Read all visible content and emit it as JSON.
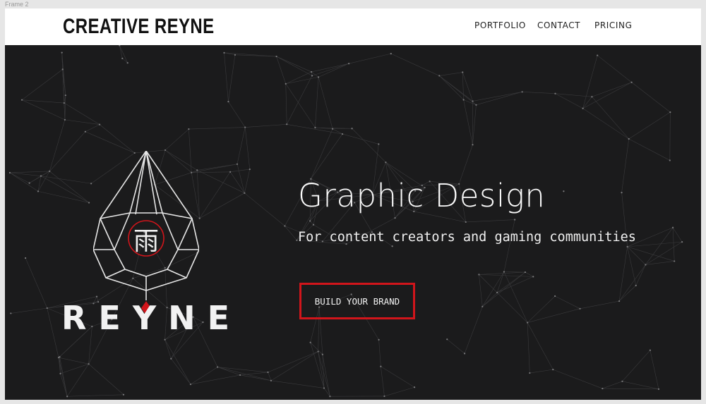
{
  "frame": {
    "label": "Frame 2"
  },
  "header": {
    "brand": "CREATIVE REYNE",
    "nav": [
      "PORTFOLIO",
      "CONTACT",
      "PRICING"
    ]
  },
  "hero": {
    "logo_word": "REYNE",
    "logo_glyph": "雨",
    "headline": "Graphic Design",
    "subline": "For content creators and gaming communities",
    "cta_label": "BUILD YOUR BRAND"
  },
  "colors": {
    "background": "#1b1b1c",
    "accent": "#d1151b",
    "header_bg": "#ffffff",
    "text_light": "#f2f2f2"
  },
  "icons": [
    "reyne-crystal-logo-icon",
    "rain-kanji-icon",
    "red-diamond-icon",
    "network-background-pattern"
  ]
}
